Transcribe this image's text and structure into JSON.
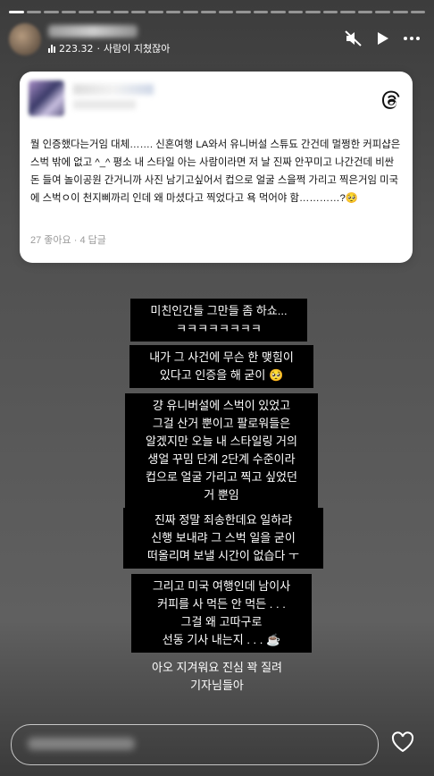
{
  "header": {
    "music_count": "223.32",
    "music_sep": "·",
    "music_title": "사람이 지쳤잖아"
  },
  "card": {
    "post_text": "뭘 인증했다는거임 대체……. 신혼여행 LA와서 유니버설 스튜됴 간건데 멀쩡한 커피샵은 스벅 밖에 없고 ^_^ 평소 내 스타일 아는 사람이라면 저 날 진짜 안꾸미고 나간건데 비싼 돈 들여 놀이공원 간거니까 사진 남기고싶어서 컵으로 얼굴 스을쩍 가리고 찍은거임 미국에 스벅ㅇ이 천지삐까리 인데 왜 마셨다고 찍었다고 욕 먹어야 함…………?🥺",
    "likes": "27 좋아요",
    "dot": "·",
    "replies": "4 답글"
  },
  "captions": [
    "미친인간들 그만들 좀 하쇼...\nㅋㅋㅋㅋㅋㅋㅋㅋ",
    "내가 그 사건에 무슨 한 맺힘이\n있다고 인증을 해 굳이 🥺",
    "걍 유니버설에 스벅이 있었고\n그걸 산거 뿐이고 팔로워들은\n알겠지만 오늘 내 스타일링 거의\n생얼 꾸밈 단계 2단계 수준이라\n컵으로 얼굴 가리고 찍고 싶었던\n거 뿐임",
    "진짜 정말 죄송한데요 일하랴\n신행 보내랴 그 스벅 일을 굳이\n떠올리며 보낼 시간이 없습다 ㅜ",
    "그리고 미국 여행인데 남이사\n커피를 사 먹든 안 먹든 . . .\n그걸 왜 고따구로\n선동 기사 내는지 . . . ☕",
    "아오 지겨워요 진심 꽉 질려\n기자님들아"
  ],
  "icons": {
    "mute": "speaker-muted-icon",
    "play": "play-icon",
    "more": "more-icon",
    "threads": "threads-logo-icon",
    "heart": "heart-icon"
  }
}
